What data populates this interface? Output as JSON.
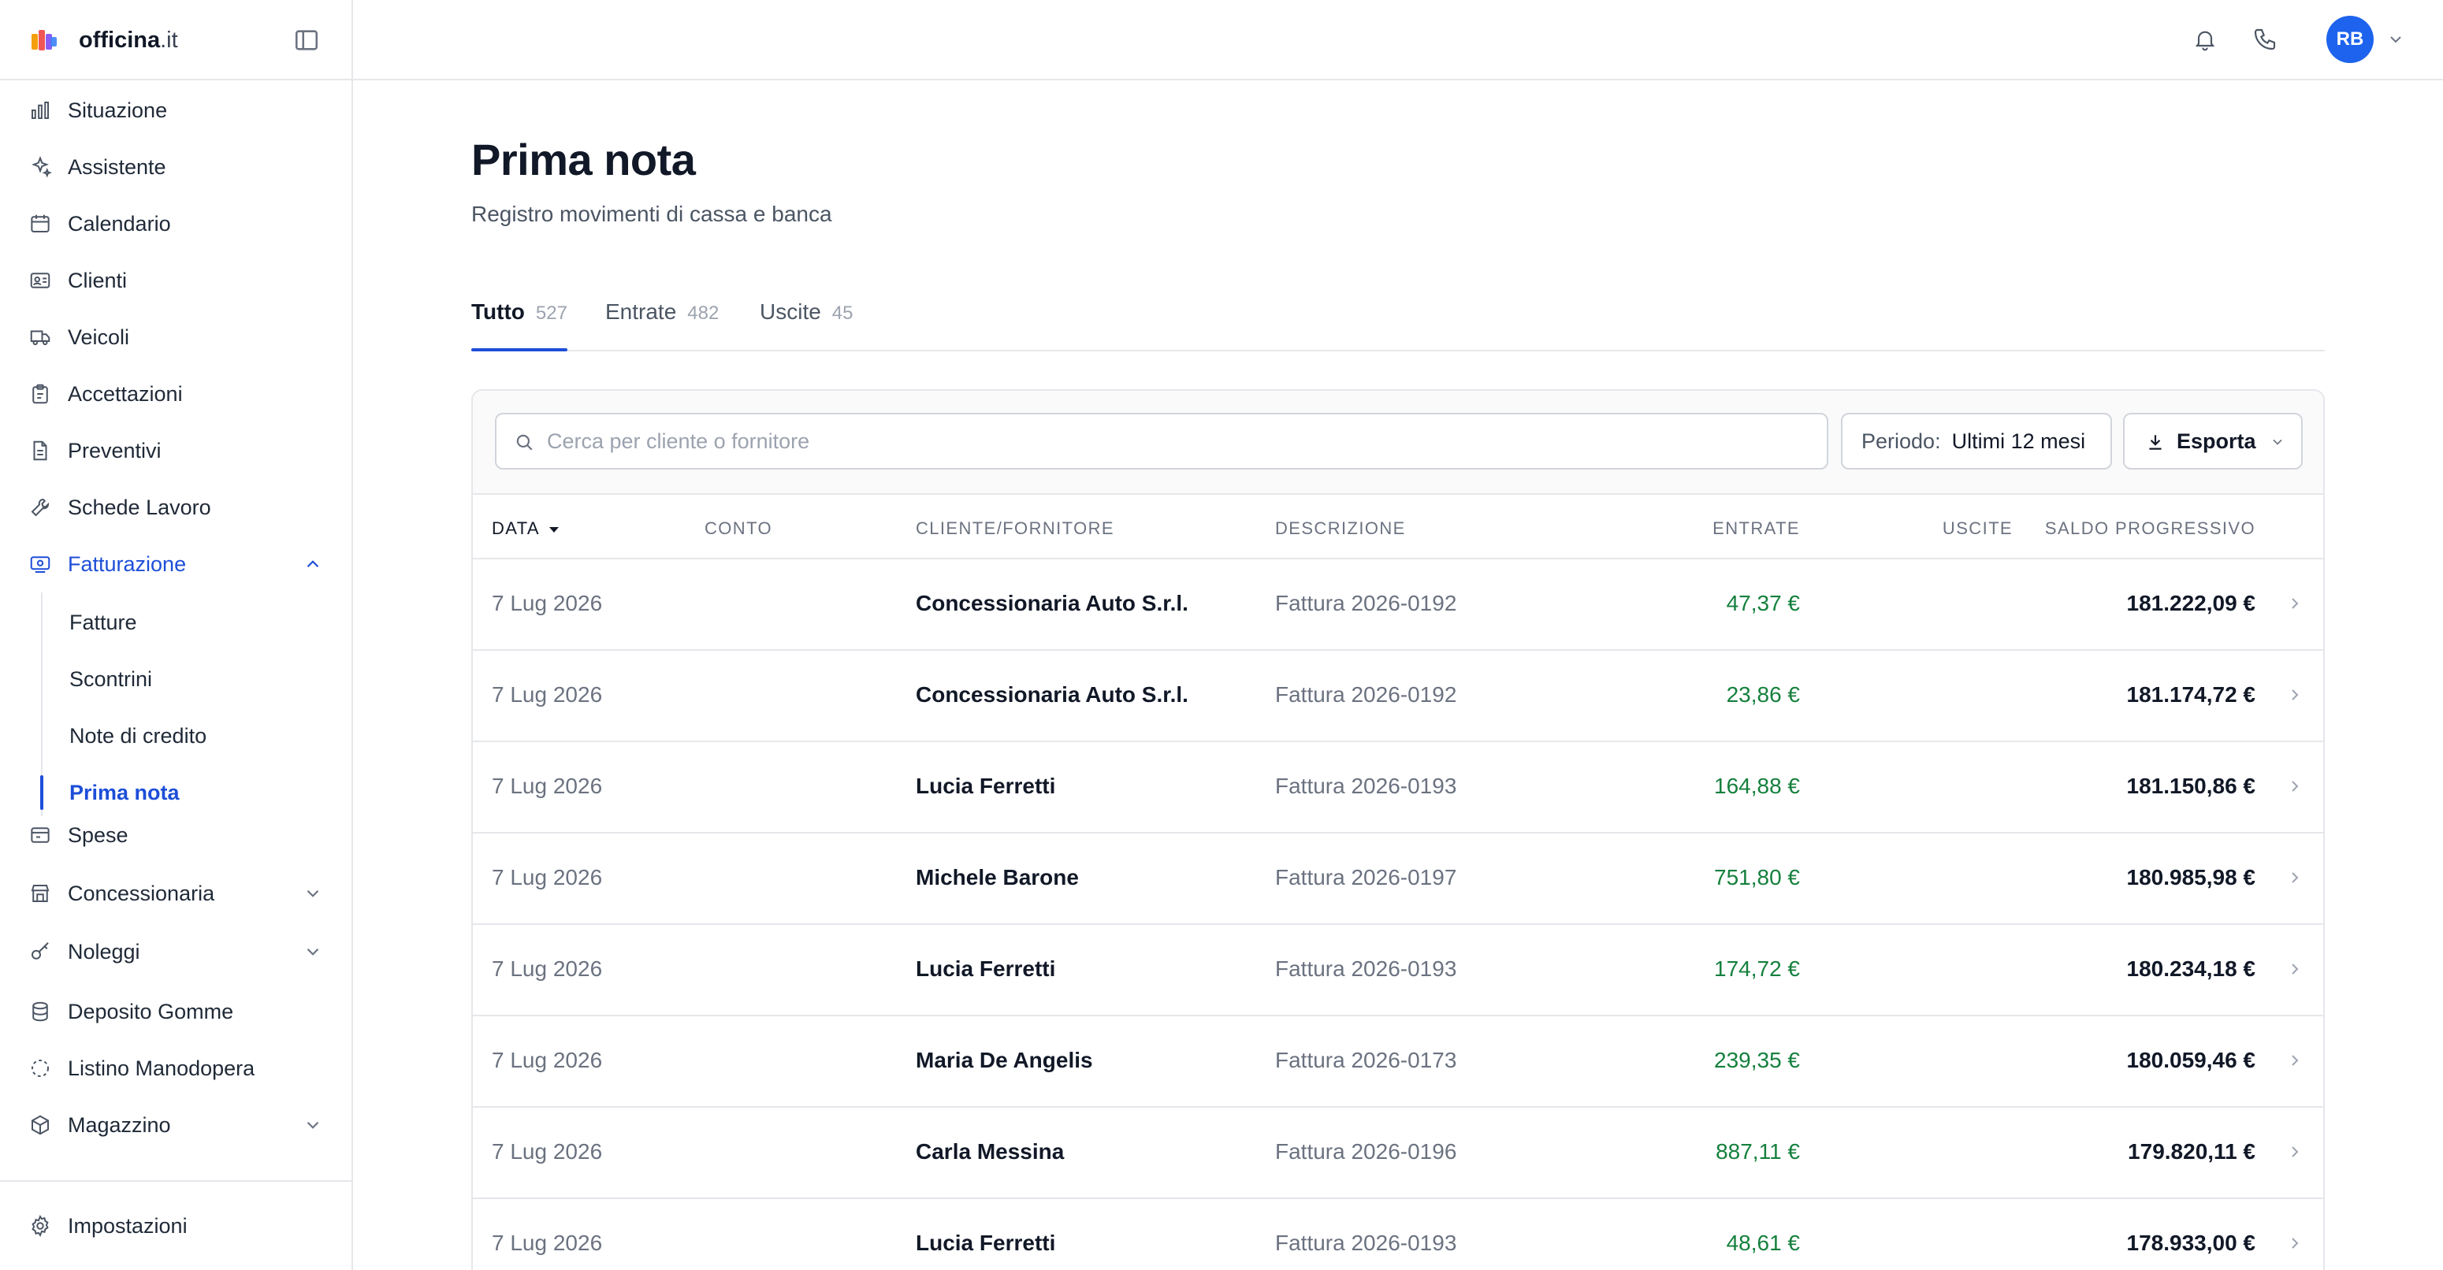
{
  "brand": {
    "name": "officina",
    "tld": ".it"
  },
  "sidebar": {
    "items": [
      {
        "label": "Situazione",
        "icon": "chart-bar-icon"
      },
      {
        "label": "Assistente",
        "icon": "sparkles-icon"
      },
      {
        "label": "Calendario",
        "icon": "calendar-icon"
      },
      {
        "label": "Clienti",
        "icon": "id-card-icon"
      },
      {
        "label": "Veicoli",
        "icon": "truck-icon"
      },
      {
        "label": "Accettazioni",
        "icon": "clipboard-icon"
      },
      {
        "label": "Preventivi",
        "icon": "document-icon"
      },
      {
        "label": "Schede Lavoro",
        "icon": "wrench-icon"
      },
      {
        "label": "Fatturazione",
        "icon": "receipt-icon",
        "expanded": true,
        "active": true
      },
      {
        "label": "Spese",
        "icon": "wallet-icon"
      },
      {
        "label": "Concessionaria",
        "icon": "store-icon",
        "expandable": true
      },
      {
        "label": "Noleggi",
        "icon": "key-icon",
        "expandable": true
      },
      {
        "label": "Deposito Gomme",
        "icon": "database-icon"
      },
      {
        "label": "Listino Manodopera",
        "icon": "dashed-circle-icon"
      },
      {
        "label": "Magazzino",
        "icon": "box-icon",
        "expandable": true
      }
    ],
    "sub_items": [
      {
        "label": "Fatture"
      },
      {
        "label": "Scontrini"
      },
      {
        "label": "Note di credito"
      },
      {
        "label": "Prima nota",
        "active": true
      }
    ],
    "settings": {
      "label": "Impostazioni",
      "icon": "gear-icon"
    }
  },
  "topbar": {
    "avatar_initials": "RB",
    "accent": "#1d63ed"
  },
  "page": {
    "title": "Prima nota",
    "subtitle": "Registro movimenti di cassa e banca"
  },
  "tabs": [
    {
      "label": "Tutto",
      "count": "527",
      "active": true
    },
    {
      "label": "Entrate",
      "count": "482"
    },
    {
      "label": "Uscite",
      "count": "45"
    }
  ],
  "toolbar": {
    "search_placeholder": "Cerca per cliente o fornitore",
    "periodo_label": "Periodo:",
    "periodo_value": "Ultimi 12 mesi",
    "export_label": "Esporta"
  },
  "table": {
    "columns": {
      "data": "DATA",
      "conto": "CONTO",
      "cliente": "CLIENTE/FORNITORE",
      "descrizione": "DESCRIZIONE",
      "entrate": "ENTRATE",
      "uscite": "USCITE",
      "saldo": "SALDO PROGRESSIVO"
    },
    "rows": [
      {
        "data": "7 Lug 2026",
        "conto": "",
        "cliente": "Concessionaria Auto S.r.l.",
        "descrizione": "Fattura 2026-0192",
        "entrate": "47,37 €",
        "uscite": "",
        "saldo": "181.222,09 €"
      },
      {
        "data": "7 Lug 2026",
        "conto": "",
        "cliente": "Concessionaria Auto S.r.l.",
        "descrizione": "Fattura 2026-0192",
        "entrate": "23,86 €",
        "uscite": "",
        "saldo": "181.174,72 €"
      },
      {
        "data": "7 Lug 2026",
        "conto": "",
        "cliente": "Lucia Ferretti",
        "descrizione": "Fattura 2026-0193",
        "entrate": "164,88 €",
        "uscite": "",
        "saldo": "181.150,86 €"
      },
      {
        "data": "7 Lug 2026",
        "conto": "",
        "cliente": "Michele Barone",
        "descrizione": "Fattura 2026-0197",
        "entrate": "751,80 €",
        "uscite": "",
        "saldo": "180.985,98 €"
      },
      {
        "data": "7 Lug 2026",
        "conto": "",
        "cliente": "Lucia Ferretti",
        "descrizione": "Fattura 2026-0193",
        "entrate": "174,72 €",
        "uscite": "",
        "saldo": "180.234,18 €"
      },
      {
        "data": "7 Lug 2026",
        "conto": "",
        "cliente": "Maria De Angelis",
        "descrizione": "Fattura 2026-0173",
        "entrate": "239,35 €",
        "uscite": "",
        "saldo": "180.059,46 €"
      },
      {
        "data": "7 Lug 2026",
        "conto": "",
        "cliente": "Carla Messina",
        "descrizione": "Fattura 2026-0196",
        "entrate": "887,11 €",
        "uscite": "",
        "saldo": "179.820,11 €"
      },
      {
        "data": "7 Lug 2026",
        "conto": "",
        "cliente": "Lucia Ferretti",
        "descrizione": "Fattura 2026-0193",
        "entrate": "48,61 €",
        "uscite": "",
        "saldo": "178.933,00 €"
      }
    ]
  }
}
